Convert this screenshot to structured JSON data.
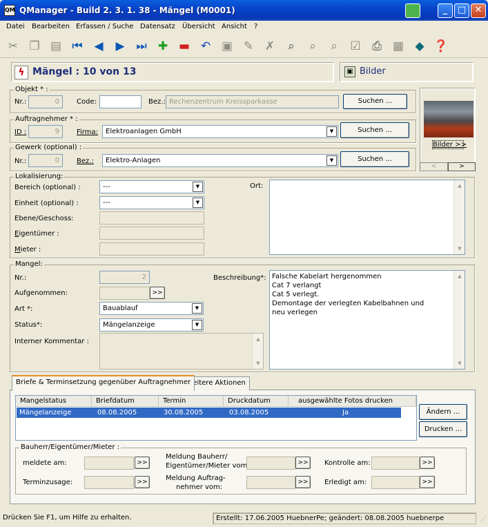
{
  "window": {
    "title": "QManager - Build 2. 3. 1. 38 - Mängel (M0001)",
    "app_icon_text": "QM",
    "minimize_glyph": "_",
    "maximize_glyph": "□",
    "close_glyph": "✕"
  },
  "menu": [
    "Datei",
    "Bearbeiten",
    "Erfassen / Suche",
    "Datensatz",
    "Übersicht",
    "Ansicht",
    "?"
  ],
  "toolbar": {
    "icons": [
      "scissors-icon",
      "copy-icon",
      "paste-icon",
      "first-record-icon",
      "previous-record-icon",
      "next-record-icon",
      "last-record-icon",
      "add-record-icon",
      "delete-record-icon",
      "undo-icon",
      "save-icon",
      "edit-tool-icon",
      "cross-tool-icon",
      "search-doc-icon",
      "search-doc2-icon",
      "search-doc3-icon",
      "checklist-icon",
      "print-icon",
      "report-icon",
      "help-book-icon",
      "context-help-icon"
    ]
  },
  "header": {
    "title": "Mängel : 10 von 13",
    "bilder_button": "Bilder"
  },
  "objekt": {
    "legend": "Objekt * :",
    "nr_label": "Nr.:",
    "nr_value": "0",
    "code_label": "Code:",
    "code_value": "",
    "bez_label": "Bez.:",
    "bez_value": "Rechenzentrum Kreissparkasse",
    "search_button": "Suchen ..."
  },
  "auftragnehmer": {
    "legend": "Auftragnehmer * :",
    "id_label": "ID :",
    "id_value": "9",
    "firma_label": "Firma:",
    "firma_value": "Elektroanlagen GmbH",
    "search_button": "Suchen ..."
  },
  "gewerk": {
    "legend": "Gewerk  (optional) :",
    "nr_label": "Nr.:",
    "nr_value": "0",
    "bez_label": "Bez.:",
    "bez_value": "Elektro-Anlagen",
    "search_button": "Suchen ..."
  },
  "photo_panel": {
    "bilder_link": "Bilder >>",
    "prev": "<",
    "next": ">"
  },
  "lokalisierung": {
    "legend": "Lokalisierung:",
    "bereich_label": "Bereich (optional) :",
    "bereich_value": "---",
    "einheit_label": "Einheit  (optional) :",
    "einheit_value": "---",
    "ebene_label": "Ebene/Geschoss:",
    "eigentuemer_label": "Eigentümer :",
    "mieter_label": "Mieter :",
    "ort_label": "Ort:"
  },
  "mangel": {
    "legend": "Mangel:",
    "nr_label": "Nr.:",
    "nr_value": "2",
    "aufgenommen_label": "Aufgenommen:",
    "aufgenommen_button": ">>",
    "art_label": "Art *:",
    "art_value": "Bauablauf",
    "status_label": "Status*:",
    "status_value": "Mängelanzeige",
    "kommentar_label": "Interner Kommentar :",
    "beschreibung_label": "Beschreibung*:",
    "beschreibung_lines": [
      "Falsche Kabelart hergenommen",
      "Cat 7 verlangt",
      "Cat 5 verlegt.",
      "Demontage der verlegten Kabelbahnen und",
      "neu verlegen"
    ]
  },
  "tabs": [
    "Briefe & Terminsetzung gegenüber Auftragnehmer",
    "Weitere Aktionen"
  ],
  "table": {
    "columns": [
      "Mangelstatus",
      "Briefdatum",
      "Termin",
      "Druckdatum",
      "ausgewählte Fotos drucken"
    ],
    "rows": [
      [
        "Mängelanzeige",
        "08.08.2005",
        "30.08.2005",
        "03.08.2005",
        "Ja"
      ]
    ],
    "aendern_button": "Ändern ...",
    "drucken_button": "Drucken ..."
  },
  "bauherr": {
    "legend": "Bauherr/Eigentümer/Mieter :",
    "meldete_label": "meldete am:",
    "terminzusage_label": "Terminzusage:",
    "meldung_bauherr_label_1": "Meldung Bauherr/",
    "meldung_bauherr_label_2": "Eigentümer/Mieter vom:",
    "meldung_auftrag_label_1": "Meldung Auftrag-",
    "meldung_auftrag_label_2": "nehmer vom:",
    "kontrolle_label": "Kontrolle am:",
    "erledigt_label": "Erledigt am:",
    "date_button": ">>"
  },
  "statusbar": {
    "help": "Drücken Sie F1, um Hilfe zu erhalten.",
    "info": "Erstellt: 17.06.2005 HuebnerPe; geändert: 08.08.2005 huebnerpe"
  },
  "colors": {
    "titlebar": "#0A5FE0",
    "selection": "#316AC5",
    "header_title": "#1E2F7A",
    "tab_active_accent": "#E68B2C"
  }
}
